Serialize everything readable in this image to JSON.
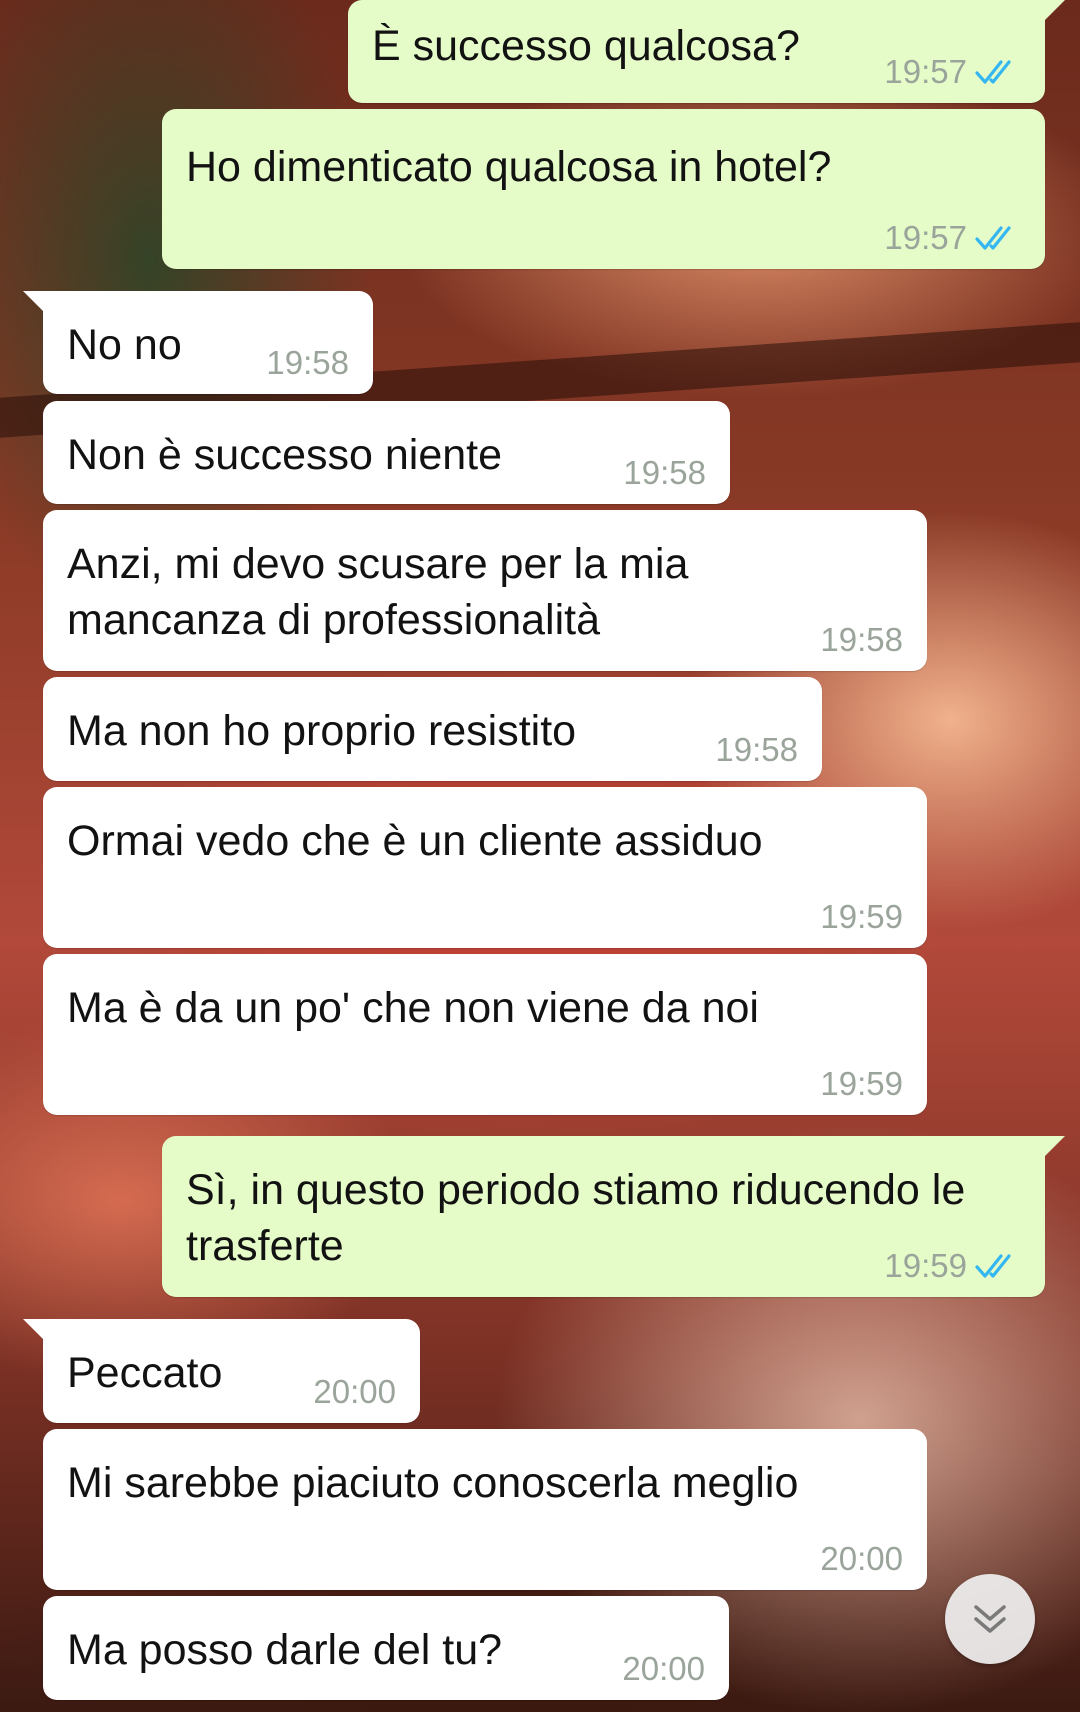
{
  "colors": {
    "outgoing_bubble": "#e5fcc9",
    "incoming_bubble": "#ffffff",
    "read_ticks": "#34b7f1",
    "timestamp": "#9aa49a"
  },
  "messages": [
    {
      "text": "È successo qualcosa?",
      "time": "19:57",
      "direction": "outgoing",
      "status_icon": "double-check-read-icon"
    },
    {
      "text": "Ho dimenticato qualcosa in hotel?",
      "time": "19:57",
      "direction": "outgoing",
      "status_icon": "double-check-read-icon"
    },
    {
      "text": "No no",
      "time": "19:58",
      "direction": "incoming"
    },
    {
      "text": "Non è successo niente",
      "time": "19:58",
      "direction": "incoming"
    },
    {
      "text": "Anzi, mi devo scusare per la mia mancanza di professionalità",
      "time": "19:58",
      "direction": "incoming"
    },
    {
      "text": "Ma non ho proprio resistito",
      "time": "19:58",
      "direction": "incoming"
    },
    {
      "text": "Ormai vedo che è un cliente assiduo",
      "time": "19:59",
      "direction": "incoming"
    },
    {
      "text": "Ma è da un po' che non viene da noi",
      "time": "19:59",
      "direction": "incoming"
    },
    {
      "text": "Sì, in questo periodo stiamo riducendo le trasferte",
      "time": "19:59",
      "direction": "outgoing",
      "status_icon": "double-check-read-icon"
    },
    {
      "text": "Peccato",
      "time": "20:00",
      "direction": "incoming"
    },
    {
      "text": "Mi sarebbe piaciuto conoscerla meglio",
      "time": "20:00",
      "direction": "incoming"
    },
    {
      "text": "Ma posso darle del tu?",
      "time": "20:00",
      "direction": "incoming"
    }
  ],
  "scroll_button": {
    "icon": "double-chevron-down-icon"
  }
}
